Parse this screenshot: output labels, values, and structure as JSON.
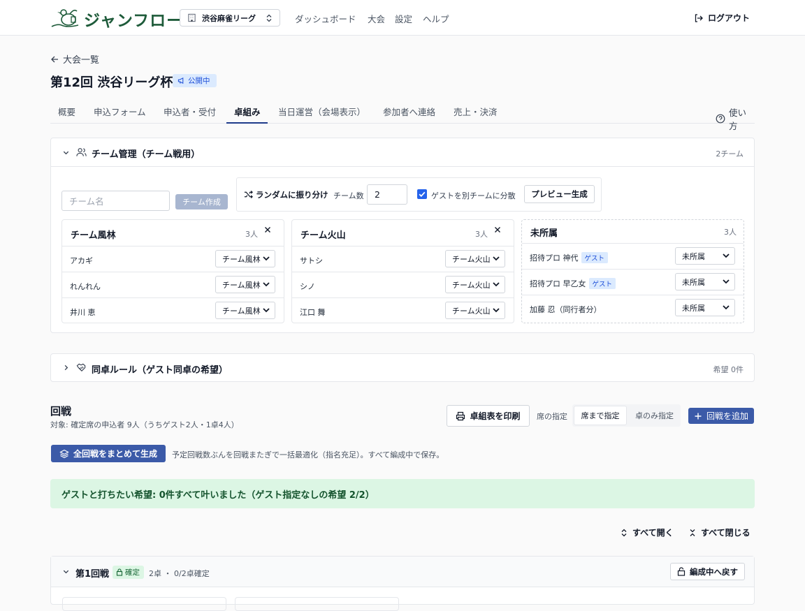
{
  "header": {
    "brand": "ジャンフロー",
    "org": "渋谷麻雀リーグ",
    "nav": [
      "ダッシュボード",
      "大会",
      "設定",
      "ヘルプ"
    ],
    "logout": "ログアウト"
  },
  "breadcrumb": "大会一覧",
  "page": {
    "title": "第12回 渋谷リーグ杯",
    "status": "公開中"
  },
  "tabs": [
    "概要",
    "申込フォーム",
    "申込者・受付",
    "卓組み",
    "当日運営（会場表示）",
    "参加者へ連絡",
    "売上・決済"
  ],
  "help": "使い方",
  "team_panel": {
    "title": "チーム管理（チーム戦用）",
    "count": "2チーム",
    "name_placeholder": "チーム名",
    "create_button": "チーム作成",
    "random_button": "ランダムに振り分け",
    "team_count_label": "チーム数",
    "team_count_value": "2",
    "guest_split_label": "ゲストを別チームに分散",
    "preview_button": "プレビュー生成",
    "teams": [
      {
        "name": "チーム風林",
        "count": "3人",
        "members": [
          {
            "name": "アカギ",
            "team": "チーム風林"
          },
          {
            "name": "れんれん",
            "team": "チーム風林"
          },
          {
            "name": "井川 恵",
            "team": "チーム風林"
          }
        ]
      },
      {
        "name": "チーム火山",
        "count": "3人",
        "members": [
          {
            "name": "サトシ",
            "team": "チーム火山"
          },
          {
            "name": "シノ",
            "team": "チーム火山"
          },
          {
            "name": "江口 舞",
            "team": "チーム火山"
          }
        ]
      }
    ],
    "unassigned": {
      "name": "未所属",
      "count": "3人",
      "members": [
        {
          "name": "招待プロ 神代",
          "tag": "ゲスト",
          "team": "未所属"
        },
        {
          "name": "招待プロ 早乙女",
          "tag": "ゲスト",
          "team": "未所属"
        },
        {
          "name": "加藤 忍（同行者分）",
          "tag": "",
          "team": "未所属"
        }
      ]
    }
  },
  "same_table_panel": {
    "title": "同卓ルール（ゲスト同卓の希望）",
    "count": "希望 0件"
  },
  "rounds": {
    "title": "回戦",
    "subtitle": "対象: 確定席の申込者 9人（うちゲスト2人・1卓4人）",
    "print_button": "卓組表を印刷",
    "seat_label": "席の指定",
    "seat_options": [
      "席まで指定",
      "卓のみ指定"
    ],
    "add_button": "回戦を追加",
    "generate_all_button": "全回戦をまとめて生成",
    "generate_note": "予定回戦数ぶんを回戦またぎで一括最適化（指名充足）。すべて編成中で保存。",
    "banner": "ゲストと打ちたい希望: 0件すべて叶いました（ゲスト指定なしの希望 2/2）",
    "expand_all": "すべて開く",
    "collapse_all": "すべて閉じる",
    "round1": {
      "title": "第1回戦",
      "status": "確定",
      "meta": "2卓 ・ 0/2卓確定",
      "revert_button": "編成中へ戻す"
    }
  },
  "colors": {
    "primary": "#3b5aa8",
    "brand": "#1e5b3a",
    "success_bg": "#dcf6e4"
  }
}
